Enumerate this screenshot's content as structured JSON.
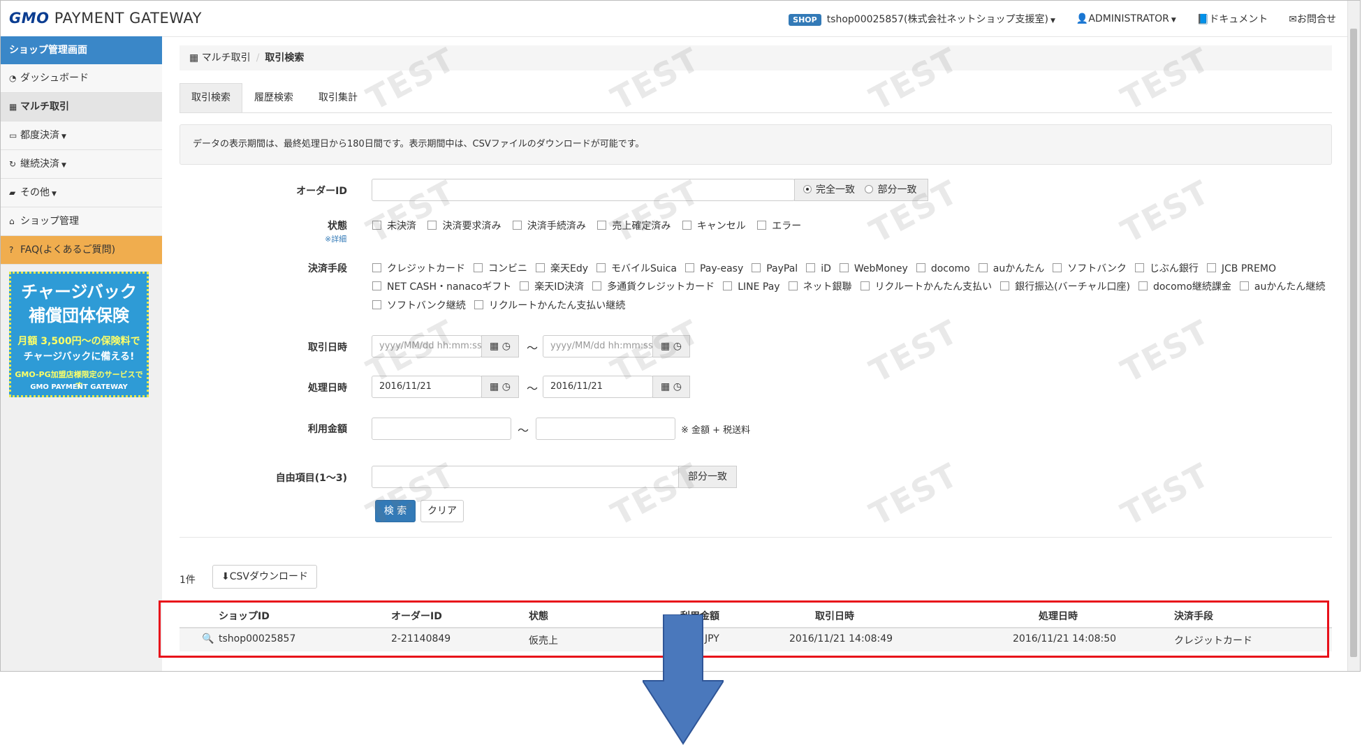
{
  "header": {
    "logo_gmo": "GMO",
    "logo_rest": "PAYMENT GATEWAY",
    "shop_badge": "SHOP",
    "shop_name": "tshop00025857(株式会社ネットショップ支援室)",
    "admin": "ADMINISTRATOR",
    "docs": "ドキュメント",
    "contact": "お問合せ"
  },
  "sidebar": {
    "heading": "ショップ管理画面",
    "items": [
      {
        "label": "ダッシュボード",
        "icon": "dashboard-icon"
      },
      {
        "label": "マルチ取引",
        "icon": "grid-icon"
      },
      {
        "label": "都度決済",
        "icon": "card-icon"
      },
      {
        "label": "継続決済",
        "icon": "refresh-icon"
      },
      {
        "label": "その他",
        "icon": "folder-icon"
      },
      {
        "label": "ショップ管理",
        "icon": "home-icon"
      }
    ],
    "faq": "FAQ(よくあるご質問)",
    "banner": {
      "line1": "チャージバック",
      "line2": "補償団体保険",
      "line3": "月額 3,500円〜の保険料で",
      "line4": "チャージバックに備える!",
      "line5": "GMO-PG加盟店様限定のサービスです",
      "line6": "GMO PAYMENT GATEWAY"
    }
  },
  "breadcrumb": {
    "parent": "マルチ取引",
    "current": "取引検索"
  },
  "tabs": [
    "取引検索",
    "履歴検索",
    "取引集計"
  ],
  "notice": "データの表示期間は、最終処理日から180日間です。表示期間中は、CSVファイルのダウンロードが可能です。",
  "form": {
    "order_id_label": "オーダーID",
    "match_exact": "完全一致",
    "match_partial": "部分一致",
    "status_label": "状態",
    "status_detail_link": "※詳細",
    "status_options": [
      "未決済",
      "決済要求済み",
      "決済手続済み",
      "売上確定済み",
      "キャンセル",
      "エラー"
    ],
    "method_label": "決済手段",
    "method_row1": [
      "クレジットカード",
      "コンビニ",
      "楽天Edy",
      "モバイルSuica",
      "Pay-easy",
      "PayPal",
      "iD",
      "WebMoney",
      "docomo",
      "auかんたん",
      "ソフトバンク",
      "じぶん銀行",
      "JCB PREMO"
    ],
    "method_row2": [
      "NET CASH・nanacoギフト",
      "楽天ID決済",
      "多通貨クレジットカード",
      "LINE Pay",
      "ネット銀聯",
      "リクルートかんたん支払い",
      "銀行振込(バーチャル口座)",
      "docomo継続課金",
      "auかんたん継続"
    ],
    "method_row3": [
      "ソフトバンク継続",
      "リクルートかんたん支払い継続"
    ],
    "trade_date_label": "取引日時",
    "date_placeholder": "yyyy/MM/dd hh:mm:ss",
    "process_date_label": "処理日時",
    "process_from": "2016/11/21",
    "process_to": "2016/11/21",
    "amount_label": "利用金額",
    "amount_note": "※ 金額 + 税送料",
    "free_label": "自由項目(1〜3)",
    "free_partial": "部分一致",
    "tilde": "〜",
    "search_btn": "検 索",
    "clear_btn": "クリア"
  },
  "results": {
    "count": "1件",
    "csv_btn": "CSVダウンロード",
    "columns": [
      "ショップID",
      "オーダーID",
      "状態",
      "利用金額",
      "取引日時",
      "処理日時",
      "決済手段"
    ],
    "rows": [
      [
        "tshop00025857",
        "2-21140849",
        "仮売上",
        "JPY",
        "2016/11/21 14:08:49",
        "2016/11/21 14:08:50",
        "クレジットカード"
      ]
    ]
  },
  "watermark_text": "TEST",
  "colors": {
    "accent": "#337ab7",
    "sidebar_head": "#3a87c8",
    "faq": "#f0ad4e",
    "highlight_box": "#e8101a",
    "arrow": "#4a78bc"
  }
}
